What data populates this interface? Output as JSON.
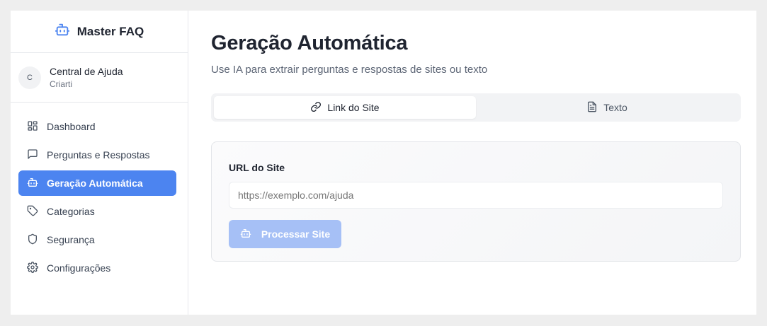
{
  "app": {
    "title": "Master FAQ",
    "accent": "#4c84f0"
  },
  "account": {
    "initial": "C",
    "name": "Central de Ajuda",
    "org": "Criarti"
  },
  "sidebar": {
    "items": [
      {
        "label": "Dashboard",
        "icon": "dashboard-icon",
        "active": false
      },
      {
        "label": "Perguntas e Respostas",
        "icon": "message-icon",
        "active": false
      },
      {
        "label": "Geração Automática",
        "icon": "bot-icon",
        "active": true
      },
      {
        "label": "Categorias",
        "icon": "tag-icon",
        "active": false
      },
      {
        "label": "Segurança",
        "icon": "shield-icon",
        "active": false
      },
      {
        "label": "Configurações",
        "icon": "gear-icon",
        "active": false
      }
    ]
  },
  "main": {
    "title": "Geração Automática",
    "subtitle": "Use IA para extrair perguntas e respostas de sites ou texto",
    "tabs": [
      {
        "label": "Link do Site",
        "icon": "link-icon",
        "active": true
      },
      {
        "label": "Texto",
        "icon": "file-text-icon",
        "active": false
      }
    ],
    "form": {
      "url_label": "URL do Site",
      "url_placeholder": "https://exemplo.com/ajuda",
      "url_value": "",
      "submit_label": "Processar Site",
      "submit_icon": "bot-icon",
      "submit_disabled": true
    }
  }
}
